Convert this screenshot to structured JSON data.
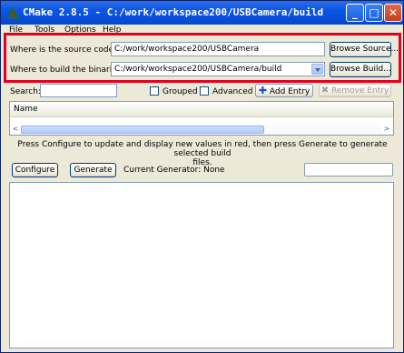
{
  "window": {
    "title": "CMake 2.8.5 - C:/work/workspace200/USBCamera/build"
  },
  "menu": {
    "file": "File",
    "tools": "Tools",
    "options": "Options",
    "help": "Help"
  },
  "source": {
    "label": "Where is the source code:",
    "value": "C:/work/workspace200/USBCamera",
    "browse": "Browse Source..."
  },
  "build": {
    "label": "Where to build the binaries:",
    "value": "C:/work/workspace200/USBCamera/build",
    "browse": "Browse Build..."
  },
  "search": {
    "label": "Search:",
    "value": ""
  },
  "options": {
    "grouped": "Grouped",
    "advanced": "Advanced",
    "grouped_checked": false,
    "advanced_checked": false
  },
  "entry": {
    "add": "Add Entry",
    "remove": "Remove Entry"
  },
  "table": {
    "column_name": "Name"
  },
  "hint": {
    "line1": "Press Configure to update and display new values in red, then press Generate to generate selected build",
    "line2": "files."
  },
  "actions": {
    "configure": "Configure",
    "generate": "Generate",
    "generator": "Current Generator: None"
  },
  "progress": {
    "value": 0
  },
  "colors": {
    "title_bar": "#0a57e6",
    "highlight": "#e3001b",
    "window_bg": "#ece9d8"
  }
}
